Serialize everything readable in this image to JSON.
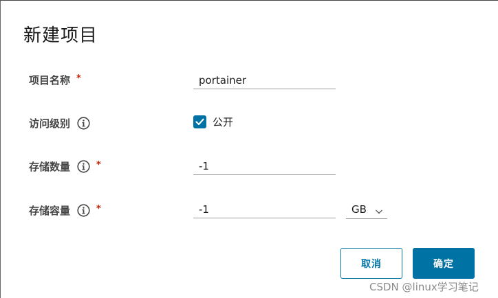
{
  "dialog": {
    "title": "新建项目"
  },
  "form": {
    "project_name": {
      "label": "项目名称",
      "required_mark": "*",
      "value": "portainer"
    },
    "access_level": {
      "label": "访问级别",
      "checkbox_label": "公开",
      "checked": true
    },
    "storage_count": {
      "label": "存储数量",
      "required_mark": "*",
      "value": "-1"
    },
    "storage_capacity": {
      "label": "存储容量",
      "required_mark": "*",
      "value": "-1",
      "unit": "GB"
    }
  },
  "actions": {
    "cancel_label": "取消",
    "ok_label": "确定"
  },
  "watermark": "CSDN @linux学习笔记",
  "colors": {
    "primary": "#0072a3",
    "required": "#c92100"
  }
}
